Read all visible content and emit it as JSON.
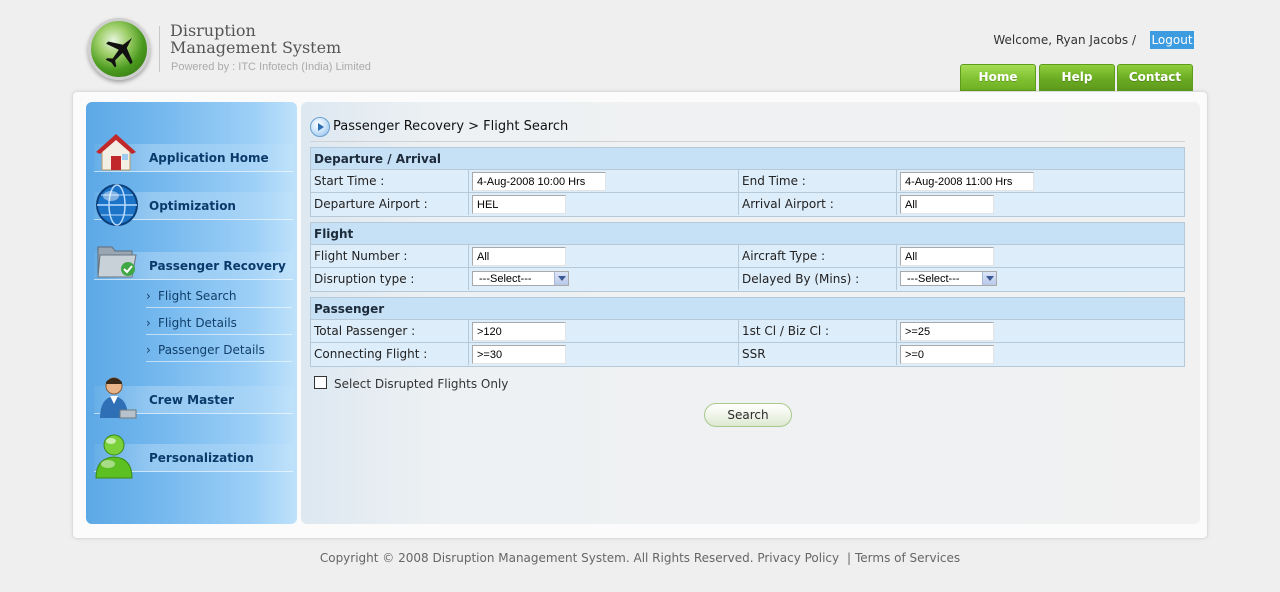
{
  "header": {
    "app_title_line1": "Disruption",
    "app_title_line2": "Management System",
    "powered_by": "Powered by : ITC Infotech (India) Limited",
    "welcome_text": "Welcome, Ryan Jacobs /",
    "logout_label": "Logout",
    "tabs": [
      {
        "label": "Home"
      },
      {
        "label": "Help"
      },
      {
        "label": "Contact"
      }
    ]
  },
  "sidebar": {
    "items": [
      {
        "label": "Application Home",
        "icon": "home-icon"
      },
      {
        "label": "Optimization",
        "icon": "globe-icon"
      },
      {
        "label": "Passenger Recovery",
        "icon": "folder-icon"
      },
      {
        "label": "Crew Master",
        "icon": "crew-icon"
      },
      {
        "label": "Personalization",
        "icon": "user-icon"
      }
    ],
    "sub_items": [
      {
        "label": "Flight Search"
      },
      {
        "label": "Flight Details"
      },
      {
        "label": "Passenger Details"
      }
    ],
    "sub_arrow": "›"
  },
  "main": {
    "heading": "Passenger Recovery > Flight Search",
    "sections": [
      {
        "title": "Departure / Arrival",
        "rows": [
          {
            "label1": "Start Time :",
            "value1": "4-Aug-2008 10:00 Hrs",
            "label2": "End Time :",
            "value2": "4-Aug-2008 11:00 Hrs"
          },
          {
            "label1": "Departure Airport :",
            "value1": "HEL",
            "label2": "Arrival Airport :",
            "value2": "All"
          }
        ]
      },
      {
        "title": "Flight",
        "rows": [
          {
            "label1": "Flight Number :",
            "value1": "All",
            "label2": "Aircraft Type :",
            "value2": "All"
          },
          {
            "label1": "Disruption type :",
            "value1": "---Select---",
            "label2": "Delayed By (Mins) :",
            "value2": "---Select---"
          }
        ]
      },
      {
        "title": "Passenger",
        "rows": [
          {
            "label1": "Total Passenger :",
            "value1": ">120",
            "label2": "1st Cl / Biz Cl :",
            "value2": ">=25"
          },
          {
            "label1": "Connecting Flight :",
            "value1": ">=30",
            "label2": "SSR",
            "value2": ">=0"
          }
        ]
      }
    ],
    "checkbox_label": "Select Disrupted Flights Only",
    "search_label": "Search"
  },
  "footer": {
    "copyright": "Copyright © 2008 Disruption Management System. All Rights Reserved.",
    "privacy": "Privacy Policy",
    "separator": "|",
    "terms": "Terms of Services"
  },
  "colors": {
    "accent_green": "#6aab22",
    "logout_blue": "#3d9be0",
    "sidebar_blue": "#5ca8e6",
    "section_header": "#c6e0f5",
    "row_bg": "#deedfa"
  }
}
